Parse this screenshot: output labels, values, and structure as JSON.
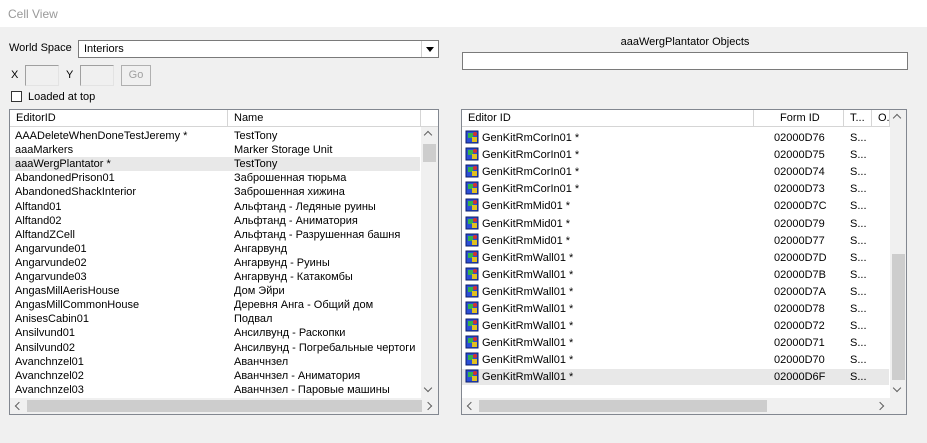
{
  "window": {
    "title": "Cell View"
  },
  "controls": {
    "world_space_label": "World Space",
    "world_space_value": "Interiors",
    "x_label": "X",
    "y_label": "Y",
    "x_value": "",
    "y_value": "",
    "go_label": "Go",
    "loaded_at_top_label": "Loaded at top",
    "loaded_at_top_checked": false
  },
  "objects_panel": {
    "title": "aaaWergPlantator Objects",
    "filter_value": ""
  },
  "cells_list": {
    "columns": [
      "EditorID",
      "Name"
    ],
    "selected_index": 2,
    "rows": [
      [
        "AAADeleteWhenDoneTestJeremy *",
        "TestTony"
      ],
      [
        "aaaMarkers",
        "Marker Storage Unit"
      ],
      [
        "aaaWergPlantator *",
        "TestTony"
      ],
      [
        "AbandonedPrison01",
        "Заброшенная тюрьма"
      ],
      [
        "AbandonedShackInterior",
        "Заброшенная хижина"
      ],
      [
        "Alftand01",
        "Альфтанд - Ледяные руины"
      ],
      [
        "Alftand02",
        "Альфтанд - Аниматория"
      ],
      [
        "AlftandZCell",
        "Альфтанд - Разрушенная башня"
      ],
      [
        "Angarvunde01",
        "Ангарвунд"
      ],
      [
        "Angarvunde02",
        "Ангарвунд - Руины"
      ],
      [
        "Angarvunde03",
        "Ангарвунд - Катакомбы"
      ],
      [
        "AngasMillAerisHouse",
        "Дом Эйри"
      ],
      [
        "AngasMillCommonHouse",
        "Деревня Анга - Общий дом"
      ],
      [
        "AnisesCabin01",
        "Подвал"
      ],
      [
        "Ansilvund01",
        "Ансилвунд - Раскопки"
      ],
      [
        "Ansilvund02",
        "Ансилвунд - Погребальные чертоги"
      ],
      [
        "Avanchnzel01",
        "Аванчнзел"
      ],
      [
        "Avanchnzel02",
        "Аванчнзел - Аниматория"
      ],
      [
        "Avanchnzel03",
        "Аванчнзел - Паровые машины"
      ]
    ]
  },
  "objects_list": {
    "columns": [
      "Editor ID",
      "Form ID",
      "T...",
      "O..."
    ],
    "selected_index": 14,
    "icon": "object-cube-icon",
    "rows": [
      [
        "GenKitRmCorIn01 *",
        "02000D76",
        "S...",
        ""
      ],
      [
        "GenKitRmCorIn01 *",
        "02000D75",
        "S...",
        ""
      ],
      [
        "GenKitRmCorIn01 *",
        "02000D74",
        "S...",
        ""
      ],
      [
        "GenKitRmCorIn01 *",
        "02000D73",
        "S...",
        ""
      ],
      [
        "GenKitRmMid01 *",
        "02000D7C",
        "S...",
        ""
      ],
      [
        "GenKitRmMid01 *",
        "02000D79",
        "S...",
        ""
      ],
      [
        "GenKitRmMid01 *",
        "02000D77",
        "S...",
        ""
      ],
      [
        "GenKitRmWall01 *",
        "02000D7D",
        "S...",
        ""
      ],
      [
        "GenKitRmWall01 *",
        "02000D7B",
        "S...",
        ""
      ],
      [
        "GenKitRmWall01 *",
        "02000D7A",
        "S...",
        ""
      ],
      [
        "GenKitRmWall01 *",
        "02000D78",
        "S...",
        ""
      ],
      [
        "GenKitRmWall01 *",
        "02000D72",
        "S...",
        ""
      ],
      [
        "GenKitRmWall01 *",
        "02000D71",
        "S...",
        ""
      ],
      [
        "GenKitRmWall01 *",
        "02000D70",
        "S...",
        ""
      ],
      [
        "GenKitRmWall01 *",
        "02000D6F",
        "S...",
        ""
      ]
    ]
  }
}
